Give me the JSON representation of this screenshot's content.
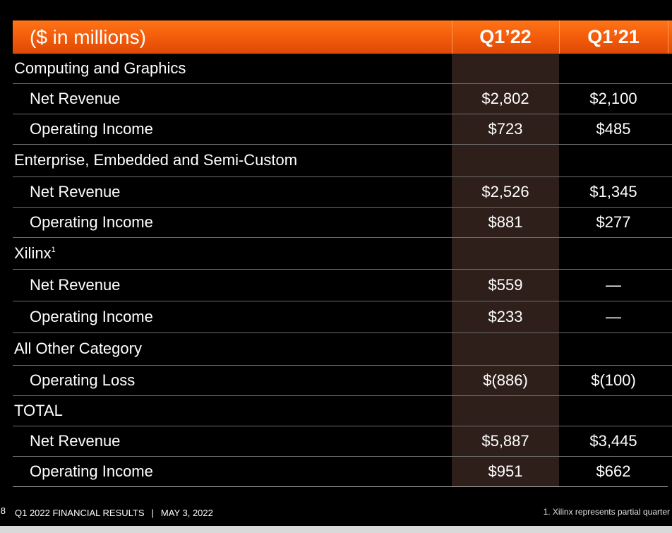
{
  "table": {
    "header": {
      "label": "($ in millions)",
      "col1": "Q1’22",
      "col2": "Q1’21"
    },
    "rows": [
      {
        "kind": "section",
        "label": "Computing and Graphics",
        "q1_22": "",
        "q1_21": ""
      },
      {
        "kind": "sub",
        "label": "Net Revenue",
        "q1_22": "$2,802",
        "q1_21": "$2,100"
      },
      {
        "kind": "sub",
        "label": "Operating Income",
        "q1_22": "$723",
        "q1_21": "$485"
      },
      {
        "kind": "section",
        "label": "Enterprise, Embedded and Semi-Custom",
        "q1_22": "",
        "q1_21": ""
      },
      {
        "kind": "sub",
        "label": "Net Revenue",
        "q1_22": "$2,526",
        "q1_21": "$1,345"
      },
      {
        "kind": "sub",
        "label": "Operating Income",
        "q1_22": "$881",
        "q1_21": "$277"
      },
      {
        "kind": "section",
        "label": "Xilinx",
        "sup": "1",
        "q1_22": "",
        "q1_21": ""
      },
      {
        "kind": "sub",
        "label": "Net Revenue",
        "q1_22": "$559",
        "q1_21": "—"
      },
      {
        "kind": "sub",
        "label": "Operating Income",
        "q1_22": "$233",
        "q1_21": "—"
      },
      {
        "kind": "section",
        "label": "All Other Category",
        "q1_22": "",
        "q1_21": ""
      },
      {
        "kind": "sub",
        "label": "Operating Loss",
        "q1_22": "$(886)",
        "q1_21": "$(100)"
      },
      {
        "kind": "section",
        "label": "TOTAL",
        "q1_22": "",
        "q1_21": ""
      },
      {
        "kind": "sub",
        "label": "Net Revenue",
        "q1_22": "$5,887",
        "q1_21": "$3,445"
      },
      {
        "kind": "sub",
        "label": "Operating Income",
        "q1_22": "$951",
        "q1_21": "$662"
      }
    ]
  },
  "footer": {
    "page_number": "8",
    "title": "Q1 2022 FINANCIAL RESULTS",
    "separator": "|",
    "date": "MAY 3, 2022",
    "footnote": "1. Xilinx represents partial quarter"
  },
  "colors": {
    "header_orange": "#f25a0a",
    "highlight_column": "#2e1f1a",
    "background": "#000000"
  }
}
